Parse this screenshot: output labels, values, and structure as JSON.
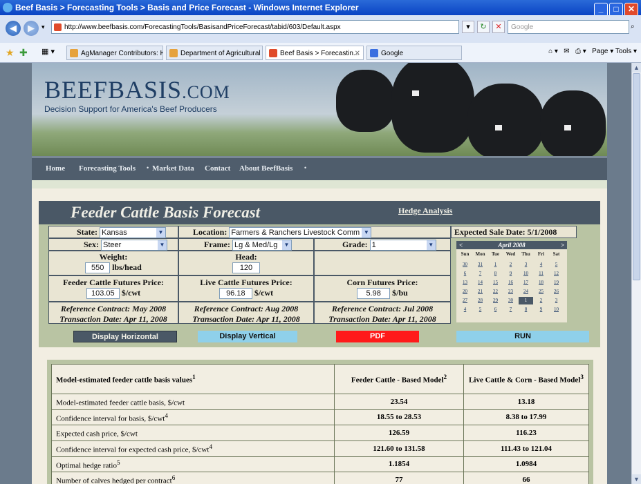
{
  "window": {
    "title": "Beef Basis > Forecasting Tools > Basis and Price Forecast - Windows Internet Explorer"
  },
  "browser": {
    "url": "http://www.beefbasis.com/ForecastingTools/BasisandPriceForecast/tabid/603/Default.aspx",
    "search_placeholder": "Google",
    "tabs": [
      {
        "label": "AgManager Contributors: K..."
      },
      {
        "label": "Department of Agricultural ..."
      },
      {
        "label": "Beef Basis > Forecastin..."
      },
      {
        "label": "Google"
      }
    ],
    "right_tools": "Page ▾  Tools ▾"
  },
  "site": {
    "logo": "BEEFBASIS",
    "logo_suffix": ".COM",
    "tagline": "Decision Support for America's Beef Producers",
    "nav": [
      "Home",
      "Forecasting Tools",
      "Market Data",
      "Contact",
      "About BeefBasis"
    ]
  },
  "panel": {
    "title": "Feeder Cattle Basis Forecast",
    "hedge_link": "Hedge Analysis",
    "state_label": "State:",
    "state_value": "Kansas",
    "location_label": "Location:",
    "location_value": "Farmers & Ranchers Livestock Comm",
    "sex_label": "Sex:",
    "sex_value": "Steer",
    "frame_label": "Frame:",
    "frame_value": "Lg & Med/Lg",
    "grade_label": "Grade:",
    "grade_value": "1",
    "weight_label": "Weight:",
    "weight_value": "550",
    "weight_unit": "lbs/head",
    "head_label": "Head:",
    "head_value": "120",
    "fc_label": "Feeder Cattle Futures Price:",
    "fc_value": "103.05",
    "fc_unit": "$/cwt",
    "lc_label": "Live Cattle Futures Price:",
    "lc_value": "96.18",
    "lc_unit": "$/cwt",
    "corn_label": "Corn Futures Price:",
    "corn_value": "5.98",
    "corn_unit": "$/bu",
    "fc_ref": "Reference Contract: May 2008",
    "fc_tx": "Transaction Date: Apr 11, 2008",
    "lc_ref": "Reference Contract: Aug 2008",
    "lc_tx": "Transaction Date: Apr 11, 2008",
    "corn_ref": "Reference Contract: Jul 2008",
    "corn_tx": "Transaction Date: Apr 11, 2008",
    "expected_sale": "Expected Sale Date: 5/1/2008"
  },
  "calendar": {
    "month": "April 2008",
    "prev": "<",
    "next": ">",
    "dow": [
      "Sun",
      "Mon",
      "Tue",
      "Wed",
      "Thu",
      "Fri",
      "Sat"
    ],
    "weeks": [
      [
        "30",
        "31",
        "1",
        "2",
        "3",
        "4",
        "5"
      ],
      [
        "6",
        "7",
        "8",
        "9",
        "10",
        "11",
        "12"
      ],
      [
        "13",
        "14",
        "15",
        "16",
        "17",
        "18",
        "19"
      ],
      [
        "20",
        "21",
        "22",
        "23",
        "24",
        "25",
        "26"
      ],
      [
        "27",
        "28",
        "29",
        "30",
        "1",
        "2",
        "3"
      ],
      [
        "4",
        "5",
        "6",
        "7",
        "8",
        "9",
        "10"
      ]
    ],
    "selected": "1"
  },
  "buttons": {
    "horizontal": "Display Horizontal",
    "vertical": "Display Vertical",
    "pdf": "PDF",
    "run": "RUN"
  },
  "results": {
    "header": [
      "Model-estimated feeder cattle basis values",
      "Feeder Cattle - Based Model",
      "Live Cattle & Corn - Based Model"
    ],
    "header_sup": [
      "1",
      "2",
      "3"
    ],
    "rows": [
      {
        "label": "Model-estimated feeder cattle basis, $/cwt",
        "sup": "",
        "a": "23.54",
        "b": "13.18"
      },
      {
        "label": "Confidence interval for basis, $/cwt",
        "sup": "4",
        "a": "18.55 to 28.53",
        "b": "8.38 to 17.99"
      },
      {
        "label": "Expected cash price, $/cwt",
        "sup": "",
        "a": "126.59",
        "b": "116.23"
      },
      {
        "label": "Confidence interval for expected cash price, $/cwt",
        "sup": "4",
        "a": "121.60 to 131.58",
        "b": "111.43 to 121.04"
      },
      {
        "label": "Optimal hedge ratio",
        "sup": "5",
        "a": "1.1854",
        "b": "1.0984"
      },
      {
        "label": "Number of calves hedged per contract",
        "sup": "6",
        "a": "77",
        "b": "66"
      }
    ]
  },
  "colors": {
    "panel_dark": "#4a5866",
    "panel_green": "#b9c4a3",
    "btn_horizontal": "#4a5866",
    "btn_vertical": "#8fd0ea",
    "btn_pdf": "#ff1a1a",
    "btn_run": "#8fd0ea"
  }
}
